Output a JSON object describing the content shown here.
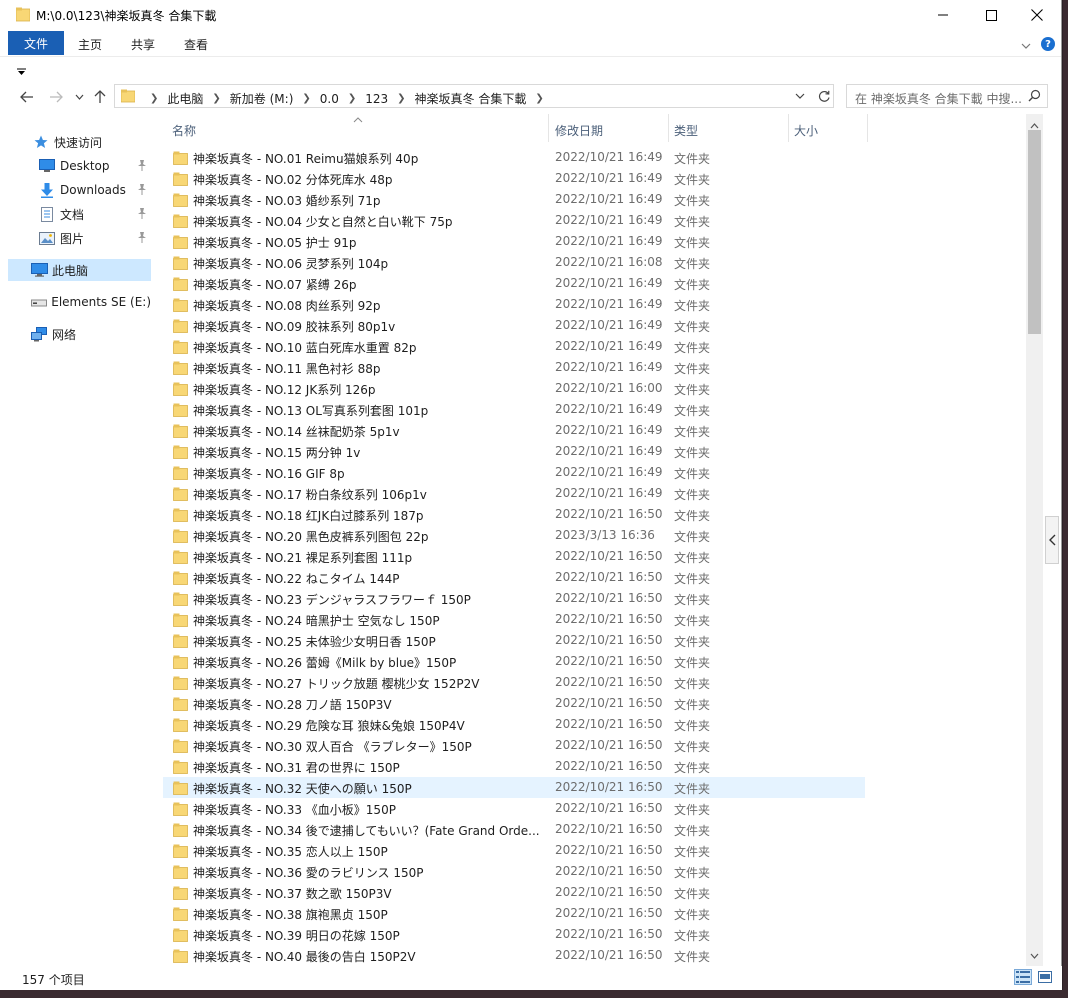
{
  "window": {
    "title": "M:\\0.0\\123\\神楽坂真冬 合集下載"
  },
  "ribbon": {
    "file_tab": "文件",
    "tabs": [
      "主页",
      "共享",
      "查看"
    ]
  },
  "address": {
    "crumbs": [
      "此电脑",
      "新加卷 (M:)",
      "0.0",
      "123",
      "神楽坂真冬 合集下載"
    ]
  },
  "search": {
    "placeholder": "在 神楽坂真冬 合集下載 中搜..."
  },
  "sidebar": {
    "items": [
      {
        "label": "快速访问",
        "icon": "star-icon"
      },
      {
        "label": "Desktop",
        "icon": "desktop-icon",
        "pinned": true
      },
      {
        "label": "Downloads",
        "icon": "download-icon",
        "pinned": true
      },
      {
        "label": "文档",
        "icon": "document-icon",
        "pinned": true
      },
      {
        "label": "图片",
        "icon": "picture-icon",
        "pinned": true
      },
      {
        "label": "此电脑",
        "icon": "computer-icon",
        "selected": true
      },
      {
        "label": "Elements SE (E:)",
        "icon": "drive-icon"
      },
      {
        "label": "网络",
        "icon": "network-icon"
      }
    ]
  },
  "columns": {
    "name": "名称",
    "date": "修改日期",
    "type": "类型",
    "size": "大小"
  },
  "files": [
    {
      "name": "神楽坂真冬 - NO.01 Reimu猫娘系列 40p",
      "date": "2022/10/21 16:49",
      "type": "文件夹"
    },
    {
      "name": "神楽坂真冬 - NO.02 分体死库水 48p",
      "date": "2022/10/21 16:49",
      "type": "文件夹"
    },
    {
      "name": "神楽坂真冬 - NO.03 婚纱系列 71p",
      "date": "2022/10/21 16:49",
      "type": "文件夹"
    },
    {
      "name": "神楽坂真冬 - NO.04 少女と自然と白い靴下 75p",
      "date": "2022/10/21 16:49",
      "type": "文件夹"
    },
    {
      "name": "神楽坂真冬 - NO.05 护士 91p",
      "date": "2022/10/21 16:49",
      "type": "文件夹"
    },
    {
      "name": "神楽坂真冬 - NO.06 灵梦系列 104p",
      "date": "2022/10/21 16:08",
      "type": "文件夹"
    },
    {
      "name": "神楽坂真冬 - NO.07 紧缚 26p",
      "date": "2022/10/21 16:49",
      "type": "文件夹"
    },
    {
      "name": "神楽坂真冬 - NO.08 肉丝系列 92p",
      "date": "2022/10/21 16:49",
      "type": "文件夹"
    },
    {
      "name": "神楽坂真冬 - NO.09 胶袜系列 80p1v",
      "date": "2022/10/21 16:49",
      "type": "文件夹"
    },
    {
      "name": "神楽坂真冬 - NO.10 蓝白死库水重置 82p",
      "date": "2022/10/21 16:49",
      "type": "文件夹"
    },
    {
      "name": "神楽坂真冬 - NO.11 黑色衬衫 88p",
      "date": "2022/10/21 16:49",
      "type": "文件夹"
    },
    {
      "name": "神楽坂真冬 - NO.12 JK系列 126p",
      "date": "2022/10/21 16:00",
      "type": "文件夹"
    },
    {
      "name": "神楽坂真冬 - NO.13 OL写真系列套图 101p",
      "date": "2022/10/21 16:49",
      "type": "文件夹"
    },
    {
      "name": "神楽坂真冬 - NO.14 丝袜配奶茶 5p1v",
      "date": "2022/10/21 16:49",
      "type": "文件夹"
    },
    {
      "name": "神楽坂真冬 - NO.15 两分钟 1v",
      "date": "2022/10/21 16:49",
      "type": "文件夹"
    },
    {
      "name": "神楽坂真冬 - NO.16 GIF 8p",
      "date": "2022/10/21 16:49",
      "type": "文件夹"
    },
    {
      "name": "神楽坂真冬 - NO.17 粉白条纹系列 106p1v",
      "date": "2022/10/21 16:49",
      "type": "文件夹"
    },
    {
      "name": "神楽坂真冬 - NO.18 红JK白过膝系列 187p",
      "date": "2022/10/21 16:50",
      "type": "文件夹"
    },
    {
      "name": "神楽坂真冬 - NO.20 黑色皮裤系列图包 22p",
      "date": "2023/3/13 16:36",
      "type": "文件夹"
    },
    {
      "name": "神楽坂真冬 - NO.21 裸足系列套图 111p",
      "date": "2022/10/21 16:50",
      "type": "文件夹"
    },
    {
      "name": "神楽坂真冬 - NO.22 ねこタイム 144P",
      "date": "2022/10/21 16:50",
      "type": "文件夹"
    },
    {
      "name": "神楽坂真冬 - NO.23 デンジャラスフラワーｆ 150P",
      "date": "2022/10/21 16:50",
      "type": "文件夹"
    },
    {
      "name": "神楽坂真冬 - NO.24 暗黑护士 空気なし 150P",
      "date": "2022/10/21 16:50",
      "type": "文件夹"
    },
    {
      "name": "神楽坂真冬 - NO.25 未体验少女明日香 150P",
      "date": "2022/10/21 16:50",
      "type": "文件夹"
    },
    {
      "name": "神楽坂真冬 - NO.26 蕾姆《Milk by blue》150P",
      "date": "2022/10/21 16:50",
      "type": "文件夹"
    },
    {
      "name": "神楽坂真冬 - NO.27 トリック放題 樱桃少女 152P2V",
      "date": "2022/10/21 16:50",
      "type": "文件夹"
    },
    {
      "name": "神楽坂真冬 - NO.28 刀ノ語 150P3V",
      "date": "2022/10/21 16:50",
      "type": "文件夹"
    },
    {
      "name": "神楽坂真冬 - NO.29 危険な耳 狼妹&兔娘 150P4V",
      "date": "2022/10/21 16:50",
      "type": "文件夹"
    },
    {
      "name": "神楽坂真冬 - NO.30 双人百合 《ラブレター》150P",
      "date": "2022/10/21 16:50",
      "type": "文件夹"
    },
    {
      "name": "神楽坂真冬 - NO.31 君の世界に 150P",
      "date": "2022/10/21 16:50",
      "type": "文件夹"
    },
    {
      "name": "神楽坂真冬 - NO.32 天使への願い 150P",
      "date": "2022/10/21 16:50",
      "type": "文件夹",
      "hover": true
    },
    {
      "name": "神楽坂真冬 - NO.33 《血小板》150P",
      "date": "2022/10/21 16:50",
      "type": "文件夹"
    },
    {
      "name": "神楽坂真冬 - NO.34 後で逮捕してもいい？(Fate Grand Orde...",
      "date": "2022/10/21 16:50",
      "type": "文件夹"
    },
    {
      "name": "神楽坂真冬 - NO.35 恋人以上 150P",
      "date": "2022/10/21 16:50",
      "type": "文件夹"
    },
    {
      "name": "神楽坂真冬 - NO.36 愛のラビリンス 150P",
      "date": "2022/10/21 16:50",
      "type": "文件夹"
    },
    {
      "name": "神楽坂真冬 - NO.37 数之歌 150P3V",
      "date": "2022/10/21 16:50",
      "type": "文件夹"
    },
    {
      "name": "神楽坂真冬 - NO.38 旗袍黑贞 150P",
      "date": "2022/10/21 16:50",
      "type": "文件夹"
    },
    {
      "name": "神楽坂真冬 - NO.39 明日の花嫁 150P",
      "date": "2022/10/21 16:50",
      "type": "文件夹"
    },
    {
      "name": "神楽坂真冬 - NO.40 最後の告白 150P2V",
      "date": "2022/10/21 16:50",
      "type": "文件夹"
    }
  ],
  "status": {
    "count": "157 个项目"
  },
  "colors": {
    "accent": "#1a5fb4",
    "folder": "#f8d775",
    "selected_nav": "#cde8ff",
    "hover_row": "#e5f3ff"
  }
}
